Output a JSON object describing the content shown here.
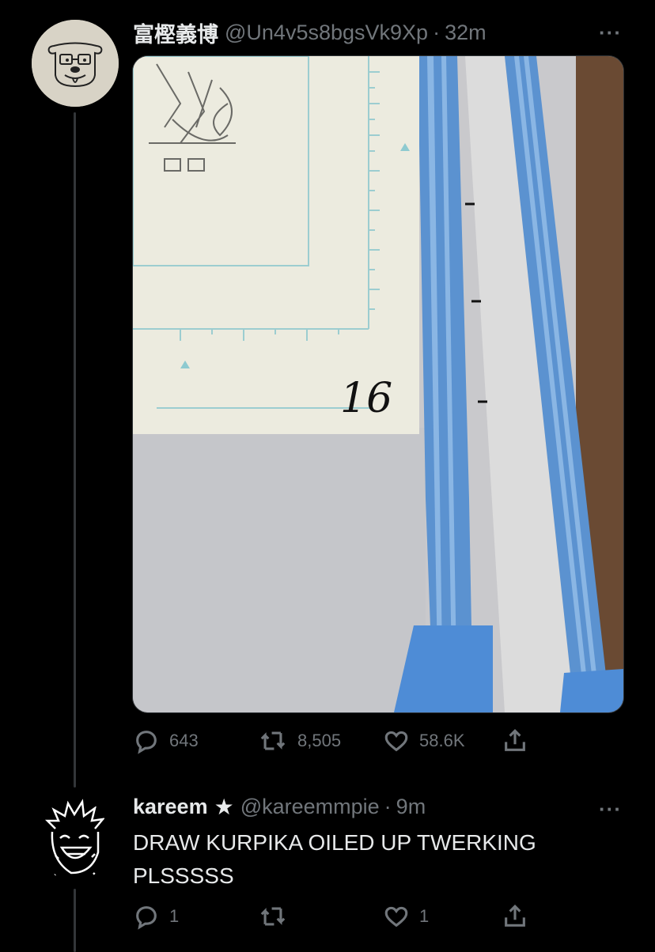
{
  "tweet": {
    "name": "富樫義博",
    "handle": "@Un4v5s8bgsVk9Xp",
    "sep": "·",
    "time": "32m",
    "more": "···",
    "photo_label": "16",
    "replies": "643",
    "retweets": "8,505",
    "likes": "58.6K"
  },
  "reply": {
    "name": "kareem",
    "star": "★",
    "handle": "@kareemmpie",
    "sep": "·",
    "time": "9m",
    "more": "···",
    "text": "DRAW KURPIKA OILED UP TWERKING PLSSSSS",
    "replies": "1",
    "retweets": "",
    "likes": "1"
  },
  "icons": {
    "reply": "reply-icon",
    "retweet": "retweet-icon",
    "like": "heart-icon",
    "share": "share-icon"
  },
  "colors": {
    "background": "#000000",
    "text": "#e7e9ea",
    "muted": "#71767b"
  }
}
